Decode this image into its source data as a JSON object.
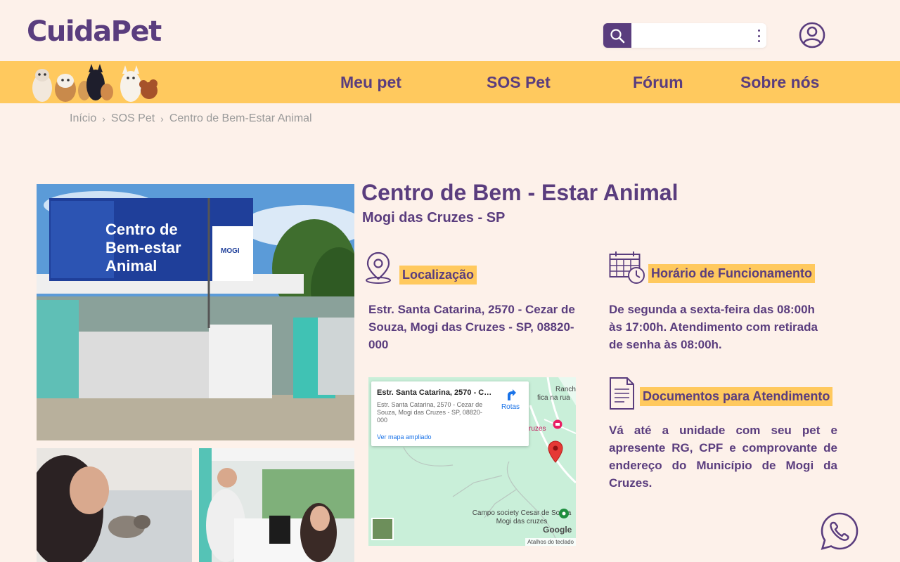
{
  "header": {
    "logo": "CuidaPet",
    "search": {
      "value": "",
      "placeholder": ""
    },
    "icons": {
      "search": "search-icon",
      "more": "kebab-menu-icon",
      "account": "user-account-icon"
    }
  },
  "nav": {
    "items": [
      {
        "label": "Meu pet"
      },
      {
        "label": "SOS Pet"
      },
      {
        "label": "Fórum"
      },
      {
        "label": "Sobre nós"
      }
    ]
  },
  "breadcrumb": {
    "items": [
      "Início",
      "SOS Pet",
      "Centro de Bem-Estar Animal"
    ]
  },
  "gallery": {
    "main_photo_sign": [
      "Centro de",
      "Bem-estar",
      "Animal"
    ],
    "sign_badge": "MOGI"
  },
  "place": {
    "title": "Centro de Bem - Estar Animal",
    "subtitle": "Mogi das Cruzes - SP"
  },
  "location": {
    "label": "Localização",
    "address": "Estr. Santa Catarina, 2570 - Cezar de Souza, Mogi das Cruzes - SP, 08820-000"
  },
  "hours": {
    "label": "Horário de Funcionamento",
    "text": "De segunda a sexta-feira das 08:00h às 17:00h. Atendimento com retirada de senha às 08:00h."
  },
  "documents": {
    "label": "Documentos para Atendimento",
    "text": "Vá até a unidade com seu pet e apresente RG, CPF e comprovante de endereço do Município de Mogi da Cruzes."
  },
  "map": {
    "card_title": "Estr. Santa Catarina, 2570 - Ce...",
    "card_address": "Estr. Santa Catarina, 2570 - Cezar de Souza, Mogi das Cruzes - SP, 08820-000",
    "routes": "Rotas",
    "view_larger": "Ver mapa ampliado",
    "label_ranch": "Ranch",
    "label_ranch2": "fica na rua",
    "label_cruzes": "ruzes",
    "label_campo": "Campo society Cesar de Souza Mogi das cruzes",
    "google": "Google",
    "keyboard": "Atalhos do teclado",
    "colors": {
      "water": "#c9efd9",
      "road": "#ffffff",
      "pin": "#e53935"
    }
  },
  "colors": {
    "background": "#fdf1ea",
    "brand_purple": "#5a3d7e",
    "accent_yellow": "#ffc95e"
  }
}
